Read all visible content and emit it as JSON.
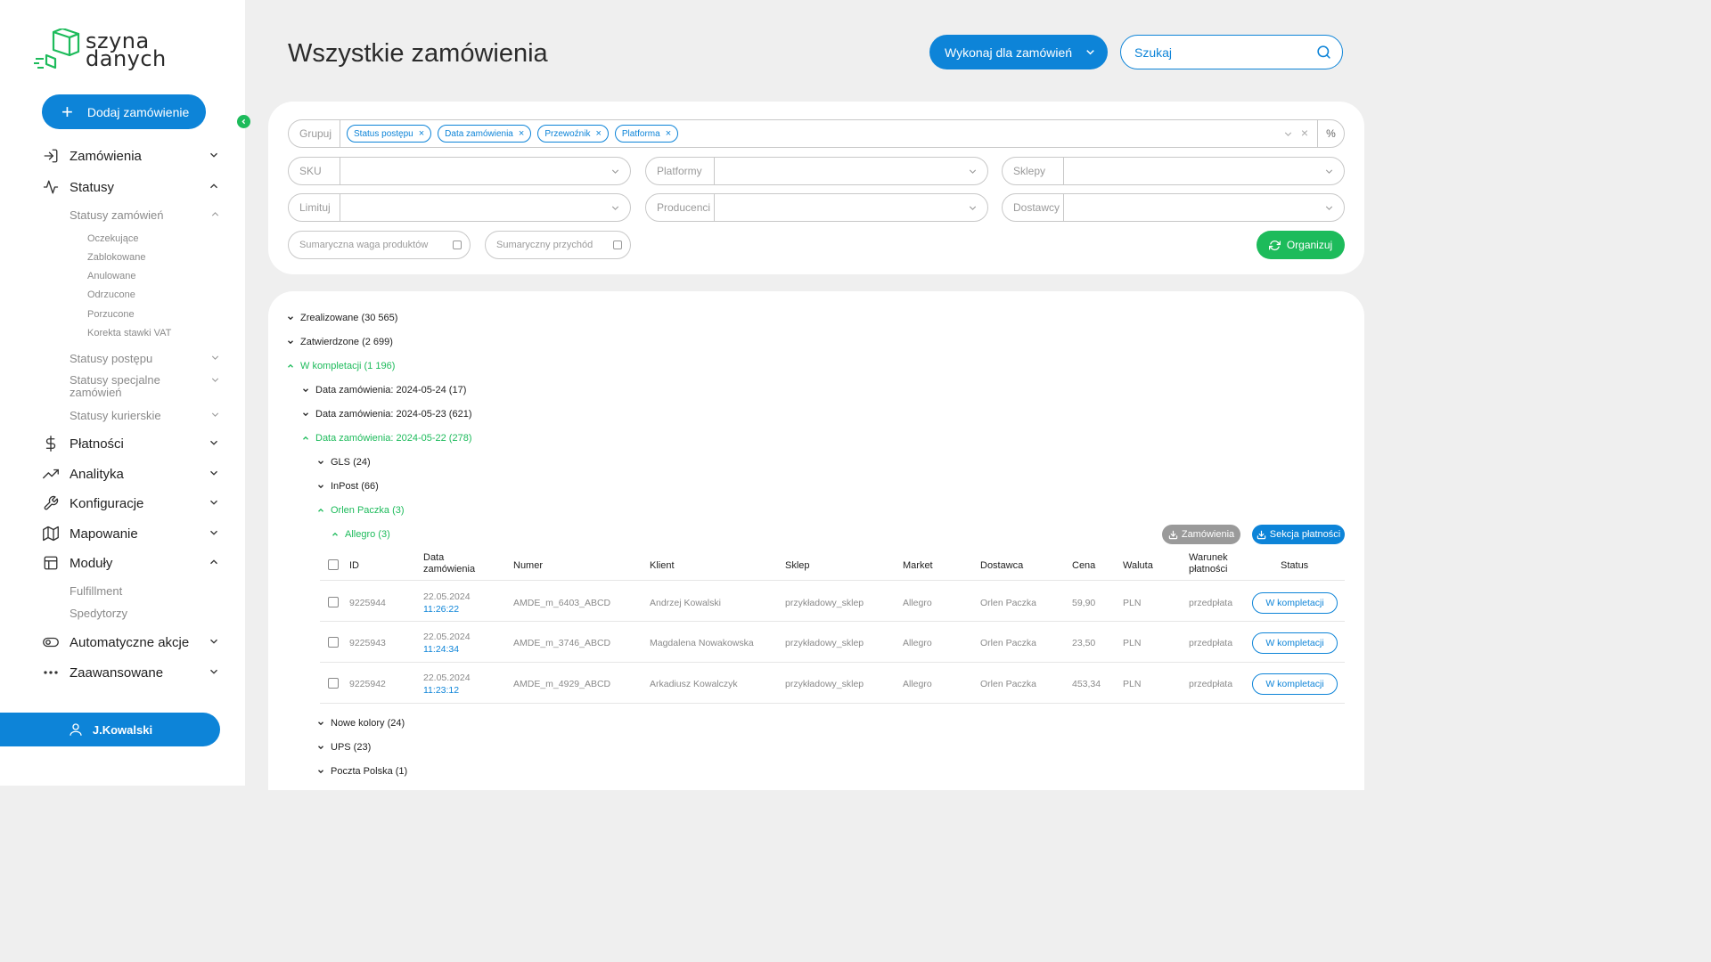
{
  "app": {
    "logo_text_line1": "szyna",
    "logo_text_line2": "danych"
  },
  "sidebar": {
    "add_order_label": "Dodaj zamówienie",
    "nav": [
      {
        "label": "Zamówienia",
        "icon": "login-arrow-icon",
        "expanded": false
      },
      {
        "label": "Statusy",
        "icon": "activity-icon",
        "expanded": true
      },
      {
        "label": "Płatności",
        "icon": "dollar-icon",
        "expanded": false
      },
      {
        "label": "Analityka",
        "icon": "trending-up-icon",
        "expanded": false
      },
      {
        "label": "Konfiguracje",
        "icon": "wrench-icon",
        "expanded": false
      },
      {
        "label": "Mapowanie",
        "icon": "map-icon",
        "expanded": false
      },
      {
        "label": "Moduły",
        "icon": "layout-icon",
        "expanded": true
      },
      {
        "label": "Automatyczne akcje",
        "icon": "toggle-icon",
        "expanded": false
      },
      {
        "label": "Zaawansowane",
        "icon": "more-icon",
        "expanded": false
      }
    ],
    "statusy_sub": [
      {
        "label": "Statusy zamówień",
        "expanded": true
      },
      {
        "label": "Statusy postępu",
        "expanded": false
      },
      {
        "label": "Statusy specjalne zamówień",
        "expanded": false
      },
      {
        "label": "Statusy kurierskie",
        "expanded": false
      }
    ],
    "statusy_zamowien_items": [
      "Oczekujące",
      "Zablokowane",
      "Anulowane",
      "Odrzucone",
      "Porzucone",
      "Korekta stawki VAT"
    ],
    "moduly_sub": [
      "Fulfillment",
      "Spedytorzy"
    ],
    "user_name": "J.Kowalski"
  },
  "header": {
    "title": "Wszystkie zamówienia",
    "execute_label": "Wykonaj dla zamówień",
    "search_placeholder": "Szukaj"
  },
  "filters": {
    "group_label": "Grupuj",
    "group_tags": [
      "Status postępu",
      "Data zamówienia",
      "Przewoźnik",
      "Platforma"
    ],
    "percent_label": "%",
    "sku_label": "SKU",
    "platforms_label": "Platformy",
    "shops_label": "Sklepy",
    "limit_label": "Limituj",
    "producers_label": "Producenci",
    "suppliers_label": "Dostawcy",
    "weight_label": "Sumaryczna waga produktów",
    "revenue_label": "Sumaryczny przychód",
    "organize_label": "Organizuj"
  },
  "tree": {
    "groups": [
      {
        "label": "Zrealizowane (30 565)",
        "open": false
      },
      {
        "label": "Zatwierdzone (2 699)",
        "open": false
      },
      {
        "label": "W kompletacji (1 196)",
        "open": true
      }
    ],
    "dates": [
      {
        "label": "Data zamówienia: 2024-05-24 (17)",
        "open": false
      },
      {
        "label": "Data zamówienia: 2024-05-23 (621)",
        "open": false
      },
      {
        "label": "Data zamówienia: 2024-05-22 (278)",
        "open": true
      }
    ],
    "carriers": [
      {
        "label": "GLS (24)",
        "open": false
      },
      {
        "label": "InPost (66)",
        "open": false
      },
      {
        "label": "Orlen Paczka (3)",
        "open": true
      }
    ],
    "platform": {
      "label": "Allegro (3)",
      "open": true
    },
    "carriers_after": [
      {
        "label": "Nowe kolory (24)",
        "open": false
      },
      {
        "label": "UPS (23)",
        "open": false
      },
      {
        "label": "Poczta Polska (1)",
        "open": false
      }
    ]
  },
  "table": {
    "btn_orders": "Zamówienia",
    "btn_payments": "Sekcja płatności",
    "headers": {
      "id": "ID",
      "date_line1": "Data",
      "date_line2": "zamówienia",
      "number": "Numer",
      "client": "Klient",
      "shop": "Sklep",
      "market": "Market",
      "supplier": "Dostawca",
      "price": "Cena",
      "currency": "Waluta",
      "terms_line1": "Warunek",
      "terms_line2": "płatności",
      "status": "Status"
    },
    "rows": [
      {
        "id": "9225944",
        "date": "22.05.2024",
        "time": "11:26:22",
        "number": "AMDE_m_6403_ABCD",
        "client": "Andrzej Kowalski",
        "shop": "przykładowy_sklep",
        "market": "Allegro",
        "supplier": "Orlen Paczka",
        "price": "59,90",
        "currency": "PLN",
        "terms": "przedpłata",
        "status": "W kompletacji"
      },
      {
        "id": "9225943",
        "date": "22.05.2024",
        "time": "11:24:34",
        "number": "AMDE_m_3746_ABCD",
        "client": "Magdalena Nowakowska",
        "shop": "przykładowy_sklep",
        "market": "Allegro",
        "supplier": "Orlen Paczka",
        "price": "23,50",
        "currency": "PLN",
        "terms": "przedpłata",
        "status": "W kompletacji"
      },
      {
        "id": "9225942",
        "date": "22.05.2024",
        "time": "11:23:12",
        "number": "AMDE_m_4929_ABCD",
        "client": "Arkadiusz Kowalczyk",
        "shop": "przykładowy_sklep",
        "market": "Allegro",
        "supplier": "Orlen Paczka",
        "price": "453,34",
        "currency": "PLN",
        "terms": "przedpłata",
        "status": "W kompletacji"
      }
    ]
  },
  "colors": {
    "primary": "#0d84d8",
    "accent_green": "#1dbb5b",
    "background": "#efefef"
  }
}
